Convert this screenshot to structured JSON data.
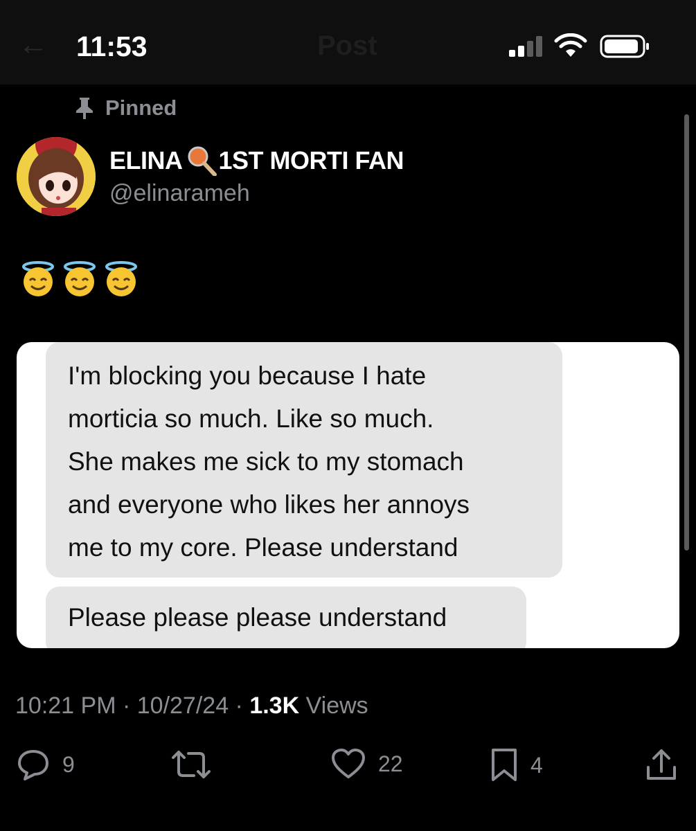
{
  "status_bar": {
    "time": "11:53"
  },
  "header": {
    "back_icon": "arrow-left-icon",
    "title": "Post"
  },
  "post": {
    "pinned_label": "Pinned",
    "author_name_part1": "ELINA",
    "author_name_part2": "1ST MORTI FAN",
    "author_name_emoji": "magnifier-icon",
    "handle": "@elinarameh",
    "text_emojis": [
      "😇",
      "😇",
      "😇"
    ],
    "image": {
      "message1": [
        "I'm blocking you because I hate",
        "morticia so much. Like so much.",
        "She makes me sick to my stomach",
        "and everyone who likes her annoys",
        "me to my core. Please understand"
      ],
      "message2": "Please please please understand"
    },
    "meta": {
      "time": "10:21 PM",
      "sep1": " · ",
      "date": "10/27/24",
      "sep2": " · ",
      "views_count": "1.3K",
      "views_label": " Views"
    },
    "actions": {
      "replies": "9",
      "reposts": "",
      "likes": "22",
      "bookmarks": "4"
    }
  },
  "colors": {
    "background": "#000000",
    "muted": "#8b8f94",
    "bubble": "#e5e5e5"
  }
}
